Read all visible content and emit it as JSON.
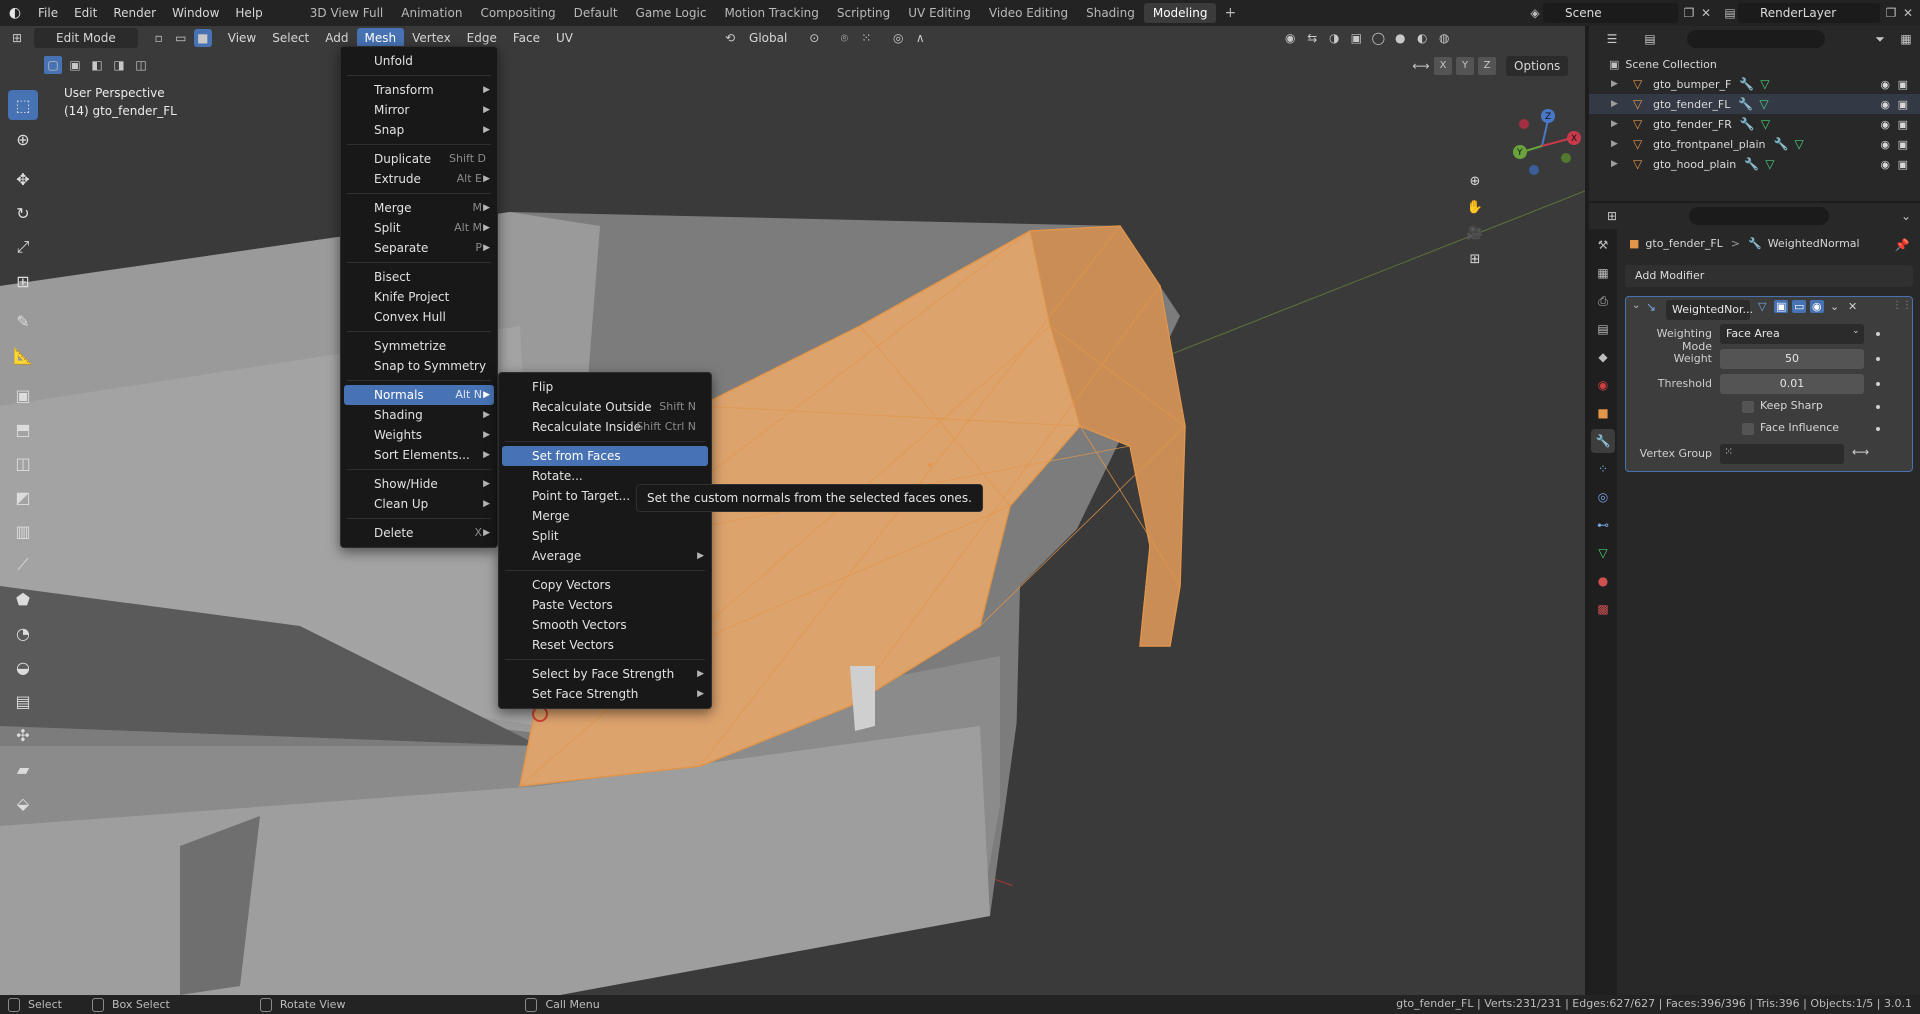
{
  "topbar": {
    "menus": [
      "File",
      "Edit",
      "Render",
      "Window",
      "Help"
    ],
    "workspaces": [
      "3D View Full",
      "Animation",
      "Compositing",
      "Default",
      "Game Logic",
      "Motion Tracking",
      "Scripting",
      "UV Editing",
      "Video Editing",
      "Shading",
      "Modeling"
    ],
    "active_workspace": "Modeling",
    "add_tab": "+",
    "scene": "Scene",
    "view_layer": "RenderLayer"
  },
  "viewport": {
    "mode": "Edit Mode",
    "menus": [
      "View",
      "Select",
      "Add",
      "Mesh",
      "Vertex",
      "Edge",
      "Face",
      "UV"
    ],
    "active_menu": "Mesh",
    "orientation": "Global",
    "options_label": "Options",
    "xyz": [
      "X",
      "Y",
      "Z"
    ],
    "perspective_label": "User Perspective",
    "object_label": "(14) gto_fender_FL",
    "gizmo_axes": [
      "X",
      "Y",
      "Z"
    ]
  },
  "mesh_menu": {
    "items": [
      {
        "label": "Unfold",
        "shortcut": "",
        "submenu": false
      },
      {
        "label": "Transform",
        "shortcut": "",
        "submenu": true
      },
      {
        "label": "Mirror",
        "shortcut": "",
        "submenu": true
      },
      {
        "label": "Snap",
        "shortcut": "",
        "submenu": true
      },
      {
        "label": "Duplicate",
        "shortcut": "Shift D",
        "submenu": false
      },
      {
        "label": "Extrude",
        "shortcut": "Alt E",
        "submenu": true
      },
      {
        "label": "Merge",
        "shortcut": "M",
        "submenu": true
      },
      {
        "label": "Split",
        "shortcut": "Alt M",
        "submenu": true
      },
      {
        "label": "Separate",
        "shortcut": "P",
        "submenu": true
      },
      {
        "label": "Bisect",
        "shortcut": "",
        "submenu": false
      },
      {
        "label": "Knife Project",
        "shortcut": "",
        "submenu": false
      },
      {
        "label": "Convex Hull",
        "shortcut": "",
        "submenu": false
      },
      {
        "label": "Symmetrize",
        "shortcut": "",
        "submenu": false
      },
      {
        "label": "Snap to Symmetry",
        "shortcut": "",
        "submenu": false
      },
      {
        "label": "Normals",
        "shortcut": "Alt N",
        "submenu": true
      },
      {
        "label": "Shading",
        "shortcut": "",
        "submenu": true
      },
      {
        "label": "Weights",
        "shortcut": "",
        "submenu": true
      },
      {
        "label": "Sort Elements...",
        "shortcut": "",
        "submenu": true
      },
      {
        "label": "Show/Hide",
        "shortcut": "",
        "submenu": true
      },
      {
        "label": "Clean Up",
        "shortcut": "",
        "submenu": true
      },
      {
        "label": "Delete",
        "shortcut": "X",
        "submenu": true
      }
    ],
    "highlighted": "Normals"
  },
  "normals_menu": {
    "items": [
      {
        "label": "Flip",
        "shortcut": "",
        "submenu": false
      },
      {
        "label": "Recalculate Outside",
        "shortcut": "Shift N",
        "submenu": false
      },
      {
        "label": "Recalculate Inside",
        "shortcut": "Shift Ctrl N",
        "submenu": false
      },
      {
        "label": "Set from Faces",
        "shortcut": "",
        "submenu": false
      },
      {
        "label": "Rotate...",
        "shortcut": "",
        "submenu": false
      },
      {
        "label": "Point to Target...",
        "shortcut": "",
        "submenu": false
      },
      {
        "label": "Merge",
        "shortcut": "",
        "submenu": false
      },
      {
        "label": "Split",
        "shortcut": "",
        "submenu": false
      },
      {
        "label": "Average",
        "shortcut": "",
        "submenu": true
      },
      {
        "label": "Copy Vectors",
        "shortcut": "",
        "submenu": false
      },
      {
        "label": "Paste Vectors",
        "shortcut": "",
        "submenu": false
      },
      {
        "label": "Smooth Vectors",
        "shortcut": "",
        "submenu": false
      },
      {
        "label": "Reset Vectors",
        "shortcut": "",
        "submenu": false
      },
      {
        "label": "Select by Face Strength",
        "shortcut": "",
        "submenu": true
      },
      {
        "label": "Set Face Strength",
        "shortcut": "",
        "submenu": true
      }
    ],
    "highlighted": "Set from Faces"
  },
  "tooltip": "Set the custom normals from the selected faces ones.",
  "outliner": {
    "title": "Scene Collection",
    "objects": [
      "gto_bumper_F",
      "gto_fender_FL",
      "gto_fender_FR",
      "gto_frontpanel_plain",
      "gto_hood_plain"
    ]
  },
  "properties": {
    "breadcrumb_object": "gto_fender_FL",
    "breadcrumb_sep": ">",
    "breadcrumb_modifier": "WeightedNormal",
    "add_modifier": "Add Modifier",
    "modifier_name": "WeightedNor...",
    "weighting_mode_label": "Weighting Mode",
    "weighting_mode_value": "Face Area",
    "weight_label": "Weight",
    "weight_value": "50",
    "threshold_label": "Threshold",
    "threshold_value": "0.01",
    "keep_sharp_label": "Keep Sharp",
    "face_influence_label": "Face Influence",
    "vertex_group_label": "Vertex Group"
  },
  "statusbar": {
    "select": "Select",
    "box_select": "Box Select",
    "rotate_view": "Rotate View",
    "call_menu": "Call Menu",
    "stats": "gto_fender_FL | Verts:231/231 | Edges:627/627 | Faces:396/396 | Tris:396 | Objects:1/5 | 3.0.1"
  },
  "colors": {
    "accent": "#4772b3",
    "selection": "#e3964a",
    "mesh_green": "#4cd07a"
  }
}
